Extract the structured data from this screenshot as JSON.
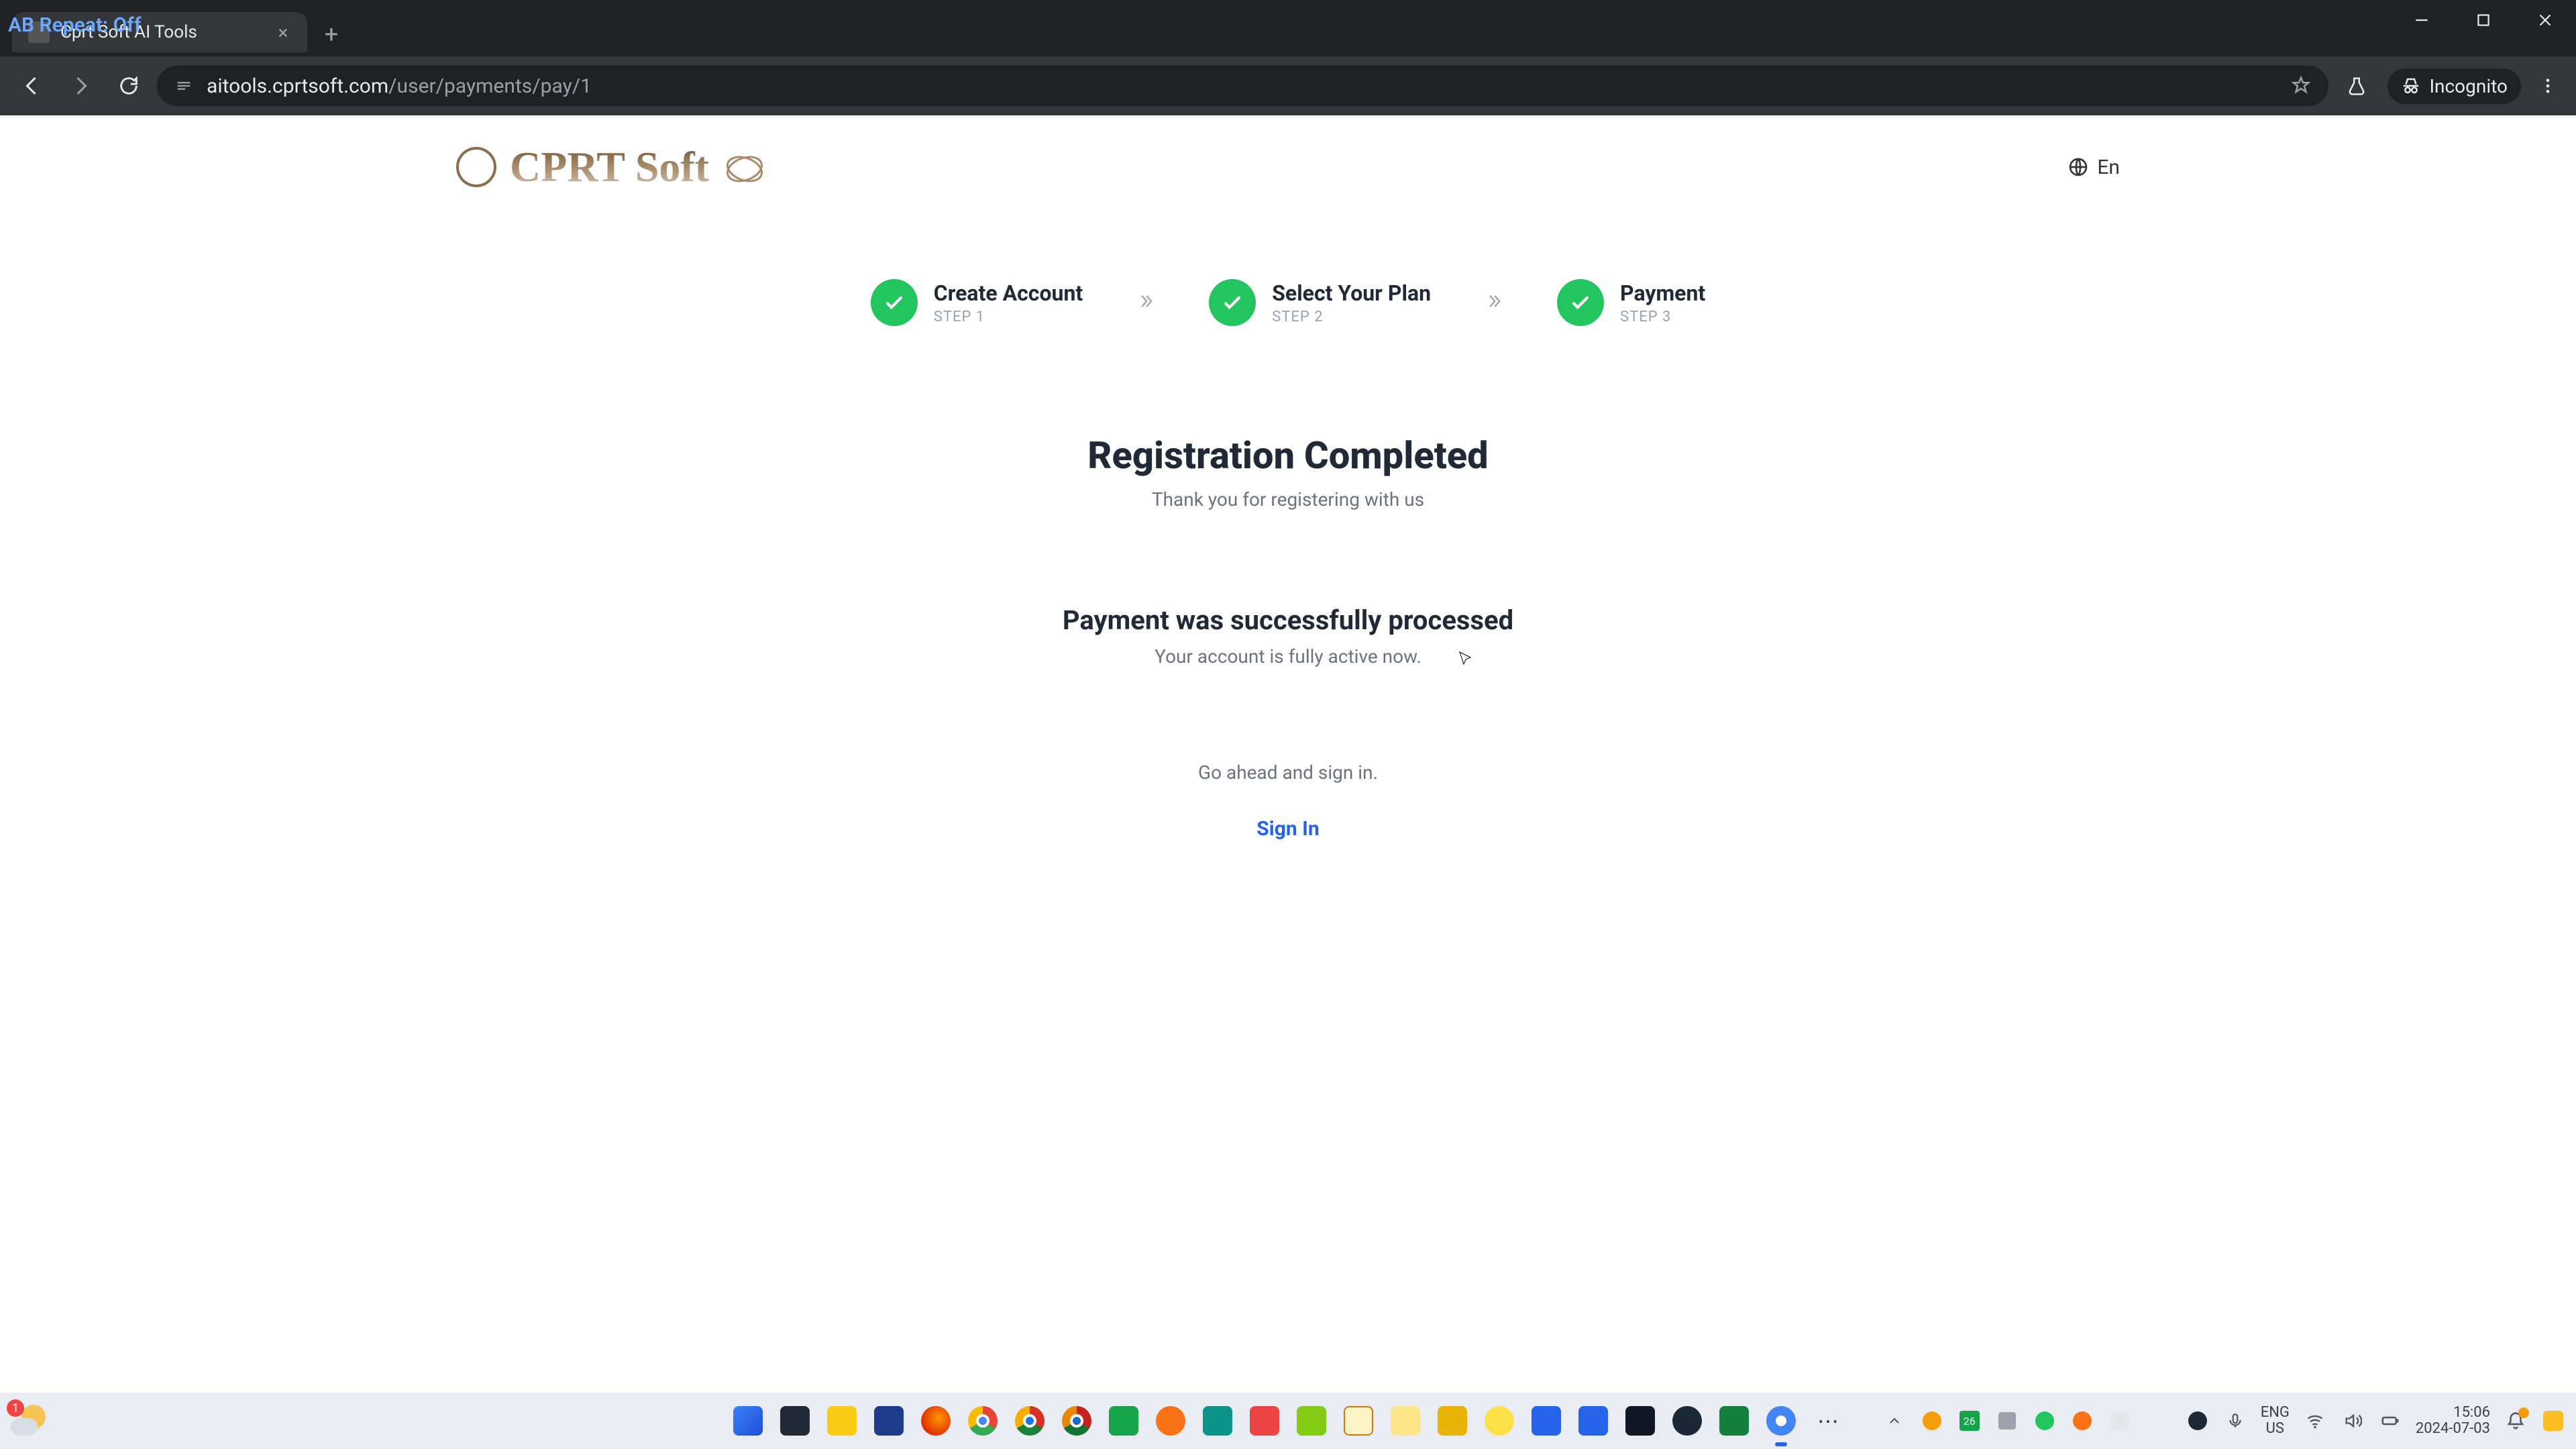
{
  "overlay": {
    "ab_repeat": "AB Repeat: Off"
  },
  "browser": {
    "tab_title": "Cprt Soft AI Tools",
    "url_host": "aitools.cprtsoft.com",
    "url_path": "/user/payments/pay/1",
    "incognito": "Incognito"
  },
  "header": {
    "brand": "CPRT Soft",
    "lang": "En"
  },
  "steps": [
    {
      "name": "Create Account",
      "sub": "STEP 1"
    },
    {
      "name": "Select Your Plan",
      "sub": "STEP 2"
    },
    {
      "name": "Payment",
      "sub": "STEP 3"
    }
  ],
  "main": {
    "title": "Registration Completed",
    "thanks": "Thank you for registering with us",
    "status_title": "Payment was successfully processed",
    "status_sub": "Your account is fully active now.",
    "cta_hint": "Go ahead and sign in.",
    "signin": "Sign In"
  },
  "taskbar": {
    "weather_badge": "1",
    "lang_top": "ENG",
    "lang_bottom": "US",
    "time": "15:06",
    "date": "2024-07-03",
    "tray_date_tile": "26"
  }
}
